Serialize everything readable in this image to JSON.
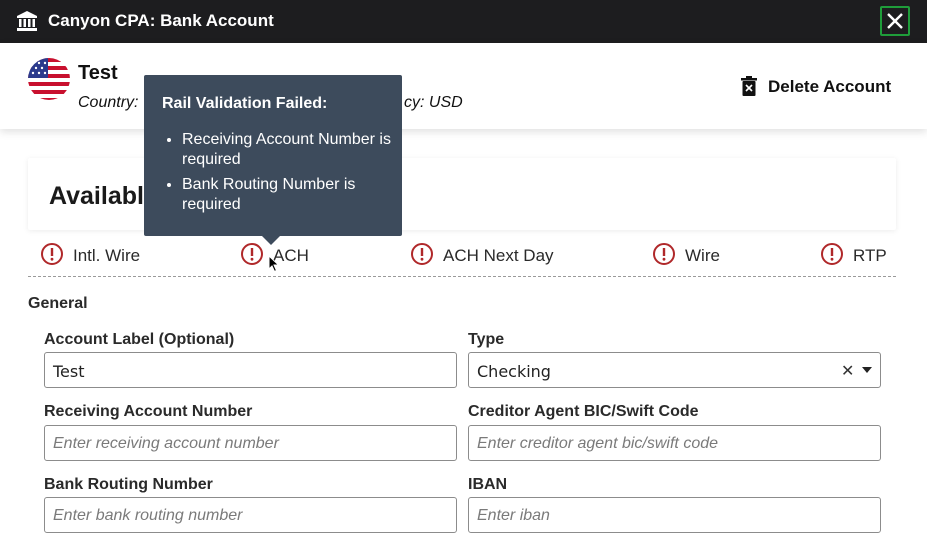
{
  "window": {
    "title": "Canyon CPA: Bank Account"
  },
  "account": {
    "name": "Test",
    "country_visible": "Country:",
    "currency_visible": "cy: USD",
    "delete_label": "Delete Account"
  },
  "available": {
    "heading_visible": "Available"
  },
  "rails": [
    {
      "label": "Intl. Wire",
      "status": "error"
    },
    {
      "label": "ACH",
      "status": "error"
    },
    {
      "label": "ACH Next Day",
      "status": "error"
    },
    {
      "label": "Wire",
      "status": "error"
    },
    {
      "label": "RTP",
      "status": "error"
    }
  ],
  "tooltip": {
    "title": "Rail Validation Failed:",
    "items": [
      "Receiving Account Number is required",
      "Bank Routing Number is required"
    ]
  },
  "form": {
    "section": "General",
    "account_label": {
      "label": "Account Label (Optional)",
      "value": "Test"
    },
    "type": {
      "label": "Type",
      "value": "Checking"
    },
    "receiving_account": {
      "label": "Receiving Account Number",
      "placeholder": "Enter receiving account number"
    },
    "creditor_bic": {
      "label": "Creditor Agent BIC/Swift Code",
      "placeholder": "Enter creditor agent bic/swift code"
    },
    "routing": {
      "label": "Bank Routing Number",
      "placeholder": "Enter bank routing number"
    },
    "iban": {
      "label": "IBAN",
      "placeholder": "Enter iban"
    }
  },
  "colors": {
    "titlebar": "#1d1d1f",
    "warning": "#b0282a",
    "tooltip": "#3d4b5c",
    "focus": "#1f9d3a"
  },
  "icons": [
    "bank-icon",
    "close-icon",
    "us-flag-icon",
    "trash-icon",
    "warning-icon",
    "cursor-icon"
  ]
}
